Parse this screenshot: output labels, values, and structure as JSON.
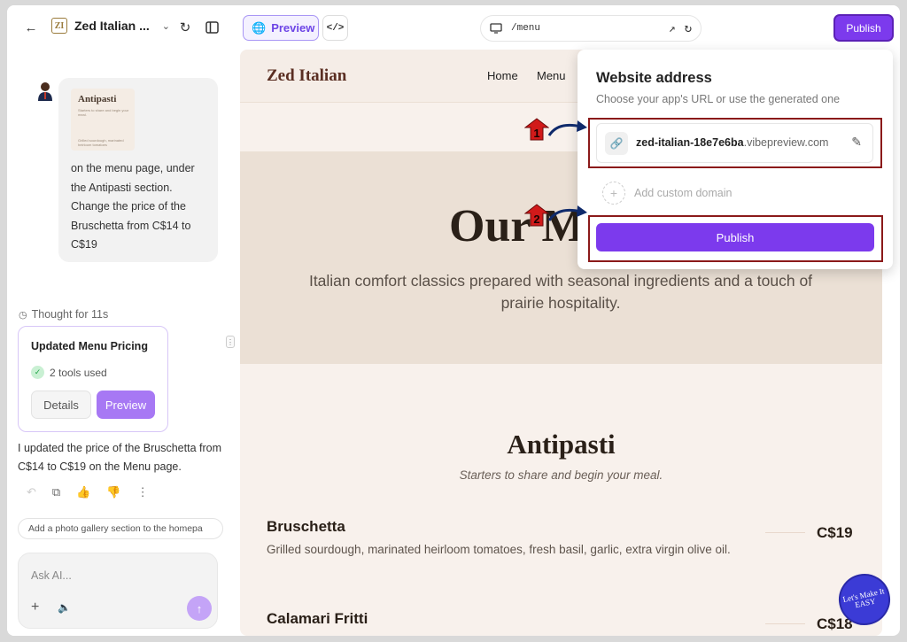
{
  "topbar": {
    "app_title": "Zed Italian ...",
    "preview_label": "Preview",
    "code_label": "</>",
    "url_path": "/menu",
    "publish_label": "Publish"
  },
  "chat": {
    "thumbnail_title": "Antipasti",
    "thumbnail_sub": "Starters to share and begin your meal.",
    "thumbnail_sub2": "Grilled sourdough, marinated heirloom tomatoes",
    "user_message": "on the menu page, under the Antipasti section. Change the price of the Bruschetta from C$14 to C$19",
    "thought_label": "Thought for 11s",
    "card_title": "Updated Menu Pricing",
    "tools_used": "2 tools used",
    "details_label": "Details",
    "preview_label": "Preview",
    "reply": "I updated the price of the Bruschetta from C$14 to C$19 on the Menu page.",
    "suggestion": "Add a photo gallery section to the homepa",
    "ask_placeholder": "Ask AI..."
  },
  "site": {
    "brand": "Zed Italian",
    "nav": [
      "Home",
      "Menu"
    ],
    "hero_title": "Our M",
    "hero_sub": "Italian comfort classics prepared with seasonal ingredients and a touch of prairie hospitality.",
    "section_title": "Antipasti",
    "section_sub": "Starters to share and begin your meal.",
    "items": [
      {
        "name": "Bruschetta",
        "desc": "Grilled sourdough, marinated heirloom tomatoes, fresh basil, garlic, extra virgin olive oil.",
        "price": "C$19"
      },
      {
        "name": "Calamari Fritti",
        "price": "C$18"
      }
    ]
  },
  "popover": {
    "title": "Website address",
    "subtitle": "Choose your app's URL or use the generated one",
    "url_sub": "zed-italian-18e7e6ba",
    "url_domain": ".vibepreview.com",
    "custom_domain": "Add custom domain",
    "publish_label": "Publish"
  },
  "markers": [
    "1",
    "2"
  ],
  "badge_text": "Let's Make It EASY",
  "colors": {
    "accent": "#7c3aed",
    "annotation_red": "#8b1a1a",
    "marker_red": "#d11a1a",
    "arrow_navy": "#0f2a6b"
  }
}
